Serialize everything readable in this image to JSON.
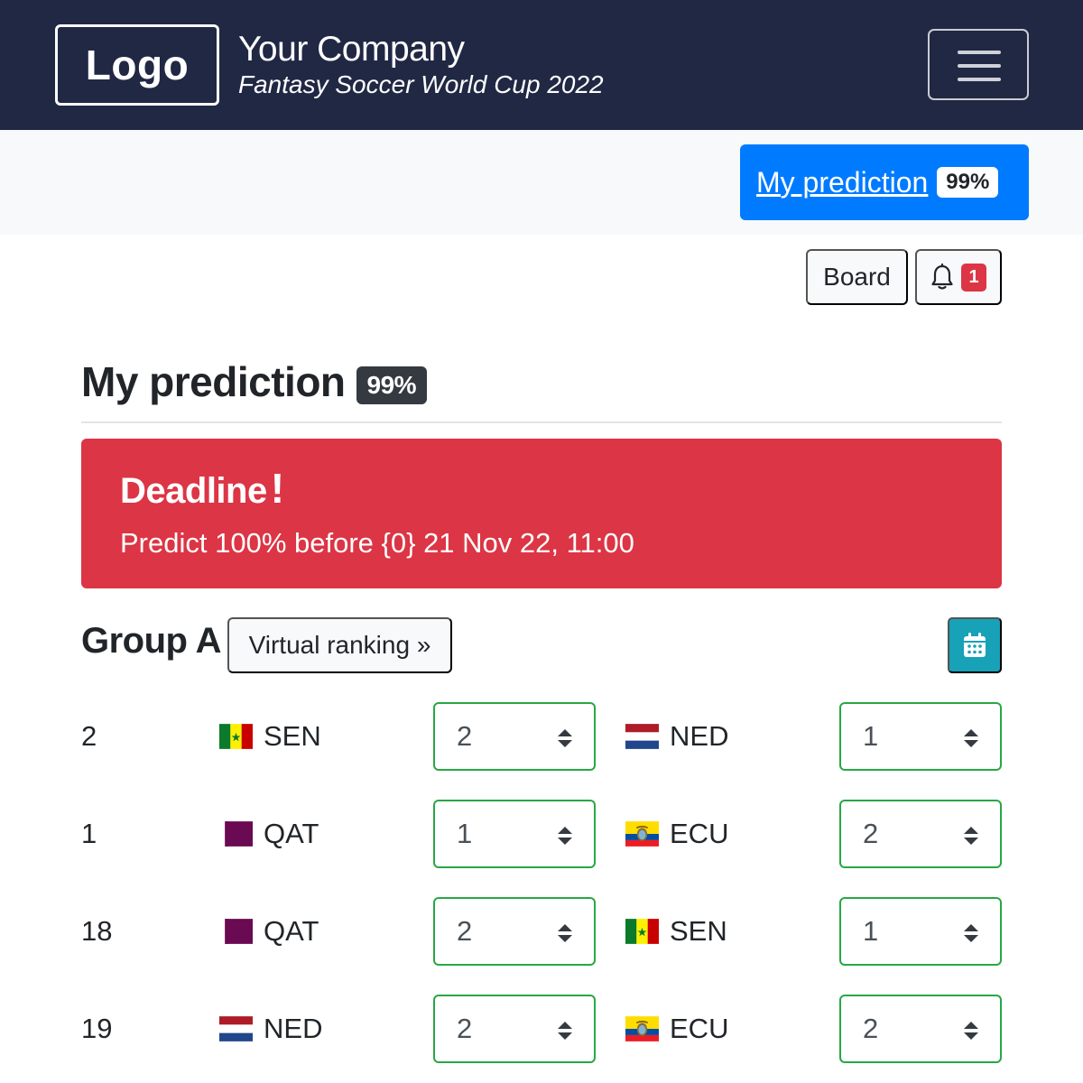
{
  "navbar": {
    "logo_label": "Logo",
    "company_name": "Your Company",
    "subtitle": "Fantasy Soccer World Cup 2022",
    "menu_icon": "hamburger-icon"
  },
  "subbar": {
    "my_prediction_label": "My prediction",
    "my_prediction_badge": "99%"
  },
  "actions": {
    "board_label": "Board",
    "notifications_icon": "bell-icon",
    "notifications_count": "1"
  },
  "page": {
    "title": "My prediction",
    "completion_badge": "99%"
  },
  "alert": {
    "title": "Deadline",
    "title_icon": "!",
    "text": "Predict 100% before {0} 21 Nov 22, 11:00",
    "color": "#dc3545"
  },
  "group": {
    "title": "Group A",
    "virtual_ranking_label": "Virtual ranking »",
    "calendar_icon": "calendar-icon"
  },
  "matches": [
    {
      "number": "2",
      "home": {
        "code": "SEN",
        "flag": "senegal-flag"
      },
      "home_score": "2",
      "away": {
        "code": "NED",
        "flag": "netherlands-flag"
      },
      "away_score": "1"
    },
    {
      "number": "1",
      "home": {
        "code": "QAT",
        "flag": "qatar-flag"
      },
      "home_score": "1",
      "away": {
        "code": "ECU",
        "flag": "ecuador-flag"
      },
      "away_score": "2"
    },
    {
      "number": "18",
      "home": {
        "code": "QAT",
        "flag": "qatar-flag"
      },
      "home_score": "2",
      "away": {
        "code": "SEN",
        "flag": "senegal-flag"
      },
      "away_score": "1"
    },
    {
      "number": "19",
      "home": {
        "code": "NED",
        "flag": "netherlands-flag"
      },
      "home_score": "2",
      "away": {
        "code": "ECU",
        "flag": "ecuador-flag"
      },
      "away_score": "2"
    }
  ],
  "colors": {
    "navbar": "#212844",
    "primary": "#007bff",
    "danger": "#dc3545",
    "info": "#17a2b8",
    "success_border": "#28a745",
    "dark_badge": "#343a40"
  }
}
